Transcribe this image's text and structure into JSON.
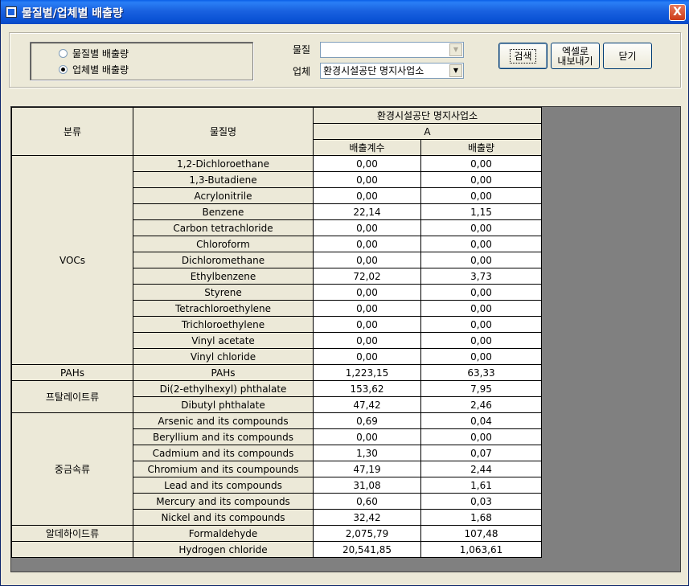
{
  "window": {
    "title": "물질별/업체별 배출량",
    "close_label": "X"
  },
  "options": {
    "radio_by_substance": "물질별 배출량",
    "radio_by_company": "업체별 배출량",
    "selected": "company"
  },
  "filters": {
    "substance_label": "물질",
    "substance_value": "",
    "company_label": "업체",
    "company_value": "환경시설공단 명지사업소"
  },
  "buttons": {
    "search": "검색",
    "export_line1": "엑셀로",
    "export_line2": "내보내기",
    "close": "닫기"
  },
  "table": {
    "header": {
      "category": "분류",
      "substance": "물질명",
      "company": "환경시설공단 명지사업소",
      "sub": "A",
      "factor": "배출계수",
      "amount": "배출량"
    },
    "groups": [
      {
        "name": "VOCs",
        "rows": [
          {
            "substance": "1,2-Dichloroethane",
            "factor": "0,00",
            "amount": "0,00"
          },
          {
            "substance": "1,3-Butadiene",
            "factor": "0,00",
            "amount": "0,00"
          },
          {
            "substance": "Acrylonitrile",
            "factor": "0,00",
            "amount": "0,00"
          },
          {
            "substance": "Benzene",
            "factor": "22,14",
            "amount": "1,15"
          },
          {
            "substance": "Carbon tetrachloride",
            "factor": "0,00",
            "amount": "0,00"
          },
          {
            "substance": "Chloroform",
            "factor": "0,00",
            "amount": "0,00"
          },
          {
            "substance": "Dichloromethane",
            "factor": "0,00",
            "amount": "0,00"
          },
          {
            "substance": "Ethylbenzene",
            "factor": "72,02",
            "amount": "3,73"
          },
          {
            "substance": "Styrene",
            "factor": "0,00",
            "amount": "0,00"
          },
          {
            "substance": "Tetrachloroethylene",
            "factor": "0,00",
            "amount": "0,00"
          },
          {
            "substance": "Trichloroethylene",
            "factor": "0,00",
            "amount": "0,00"
          },
          {
            "substance": "Vinyl acetate",
            "factor": "0,00",
            "amount": "0,00"
          },
          {
            "substance": "Vinyl chloride",
            "factor": "0,00",
            "amount": "0,00"
          }
        ]
      },
      {
        "name": "PAHs",
        "rows": [
          {
            "substance": "PAHs",
            "factor": "1,223,15",
            "amount": "63,33"
          }
        ]
      },
      {
        "name": "프탈레이트류",
        "rows": [
          {
            "substance": "Di(2-ethylhexyl) phthalate",
            "factor": "153,62",
            "amount": "7,95"
          },
          {
            "substance": "Dibutyl phthalate",
            "factor": "47,42",
            "amount": "2,46"
          }
        ]
      },
      {
        "name": "중금속류",
        "rows": [
          {
            "substance": "Arsenic and its compounds",
            "factor": "0,69",
            "amount": "0,04"
          },
          {
            "substance": "Beryllium and its compounds",
            "factor": "0,00",
            "amount": "0,00"
          },
          {
            "substance": "Cadmium and its compounds",
            "factor": "1,30",
            "amount": "0,07"
          },
          {
            "substance": "Chromium and its coumpounds",
            "factor": "47,19",
            "amount": "2,44"
          },
          {
            "substance": "Lead and its compounds",
            "factor": "31,08",
            "amount": "1,61"
          },
          {
            "substance": "Mercury and its compounds",
            "factor": "0,60",
            "amount": "0,03"
          },
          {
            "substance": "Nickel and its compounds",
            "factor": "32,42",
            "amount": "1,68"
          }
        ]
      },
      {
        "name": "알데하이드류",
        "rows": [
          {
            "substance": "Formaldehyde",
            "factor": "2,075,79",
            "amount": "107,48"
          }
        ]
      },
      {
        "name": "",
        "rows": [
          {
            "substance": "Hydrogen chloride",
            "factor": "20,541,85",
            "amount": "1,063,61"
          }
        ]
      }
    ]
  }
}
